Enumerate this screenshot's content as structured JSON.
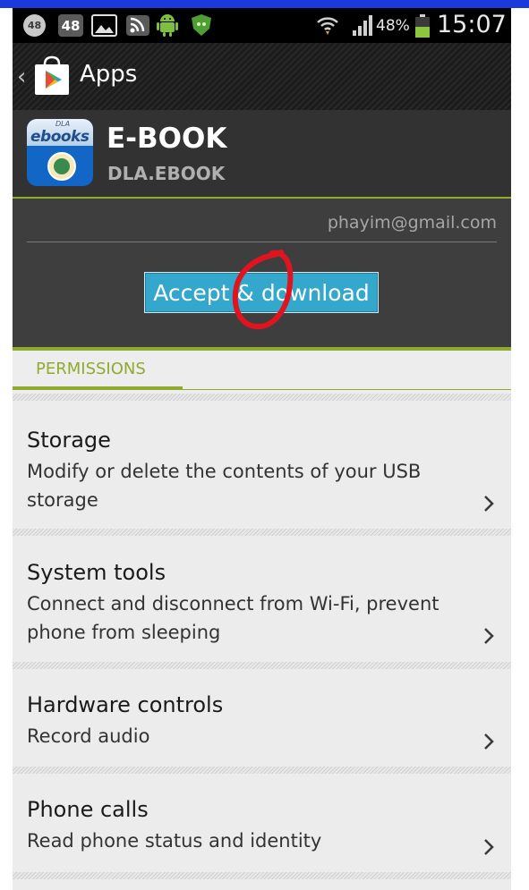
{
  "status_bar": {
    "notification_count_circle": "48",
    "notification_count_square": "48",
    "battery_percent": "48%",
    "time": "15:07",
    "icons": [
      "count-badge-icon",
      "count-square-icon",
      "image-icon",
      "rss-icon",
      "android-icon",
      "shield-icon",
      "wifi-icon",
      "signal-icon",
      "battery-icon"
    ]
  },
  "action_bar": {
    "title": "Apps",
    "icons": [
      "back-chevron-icon",
      "play-store-icon"
    ]
  },
  "app": {
    "name": "E-BOOK",
    "developer": "DLA.EBOOK",
    "icon_text_small": "DLA",
    "icon_text": "ebooks"
  },
  "account": {
    "email": "phayim@gmail.com"
  },
  "accept_button": {
    "label": "Accept & download"
  },
  "tabs": [
    {
      "label": "PERMISSIONS",
      "active": true
    }
  ],
  "permissions": [
    {
      "title": "Storage",
      "description": "Modify or delete the contents of your USB storage"
    },
    {
      "title": "System tools",
      "description": "Connect and disconnect from Wi-Fi, prevent phone from sleeping"
    },
    {
      "title": "Hardware controls",
      "description": "Record audio"
    },
    {
      "title": "Phone calls",
      "description": "Read phone status and identity"
    }
  ],
  "colors": {
    "accent_green": "#8faa2f",
    "button_blue": "#33a7cc",
    "annotation_red": "#e0141e"
  }
}
